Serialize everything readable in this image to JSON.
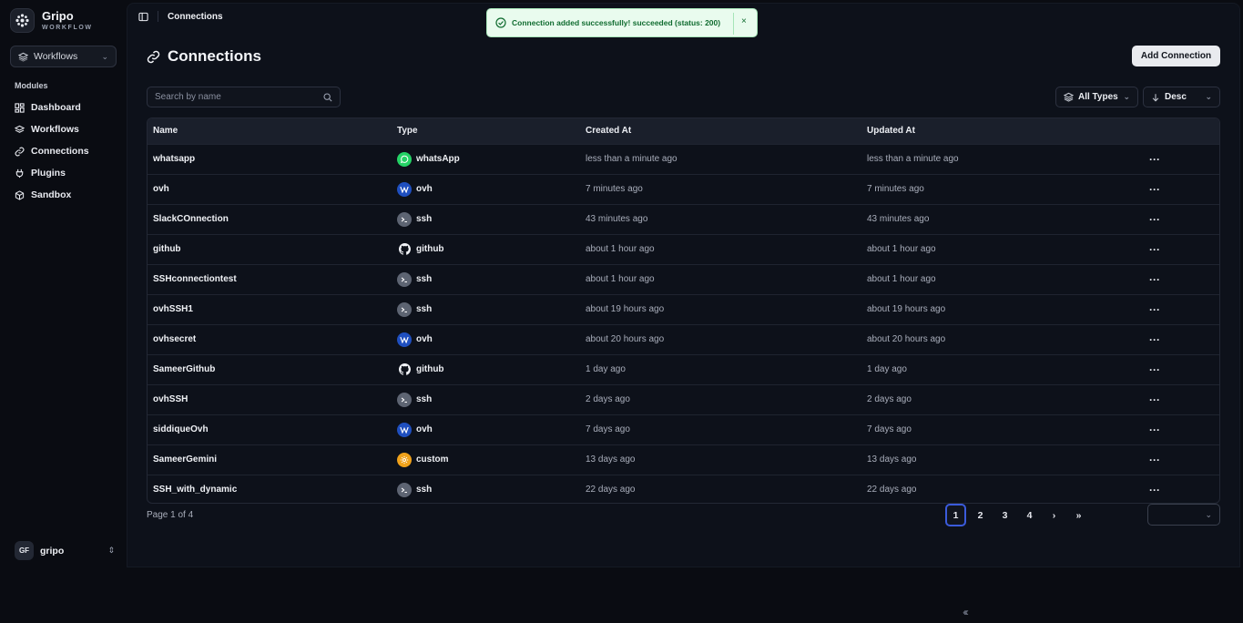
{
  "brand": {
    "name": "Gripo",
    "sub": "WORKFLOW"
  },
  "workspace_select": {
    "value": "Workflows"
  },
  "sidebar": {
    "section_label": "Modules",
    "items": [
      {
        "label": "Dashboard",
        "icon": "dashboard-icon"
      },
      {
        "label": "Workflows",
        "icon": "layers-icon"
      },
      {
        "label": "Connections",
        "icon": "link-icon"
      },
      {
        "label": "Plugins",
        "icon": "plug-icon"
      },
      {
        "label": "Sandbox",
        "icon": "cube-icon"
      }
    ]
  },
  "user": {
    "initials": "GF",
    "name": "gripo"
  },
  "breadcrumb": {
    "current": "Connections"
  },
  "page": {
    "title": "Connections",
    "add_label": "Add Connection"
  },
  "search": {
    "placeholder": "Search by name",
    "value": ""
  },
  "filters": {
    "type_value": "All Types",
    "sort_value": "Desc"
  },
  "table": {
    "columns": [
      "Name",
      "Type",
      "Created At",
      "Updated At"
    ],
    "rows": [
      {
        "name": "whatsapp",
        "type": "whatsApp",
        "icon": "whatsapp",
        "created": "less than a minute ago",
        "updated": "less than a minute ago"
      },
      {
        "name": "ovh",
        "type": "ovh",
        "icon": "ovh",
        "created": "7 minutes ago",
        "updated": "7 minutes ago"
      },
      {
        "name": "SlackCOnnection",
        "type": "ssh",
        "icon": "ssh",
        "created": "43 minutes ago",
        "updated": "43 minutes ago"
      },
      {
        "name": "github",
        "type": "github",
        "icon": "github",
        "created": "about 1 hour ago",
        "updated": "about 1 hour ago"
      },
      {
        "name": "SSHconnectiontest",
        "type": "ssh",
        "icon": "ssh",
        "created": "about 1 hour ago",
        "updated": "about 1 hour ago"
      },
      {
        "name": "ovhSSH1",
        "type": "ssh",
        "icon": "ssh",
        "created": "about 19 hours ago",
        "updated": "about 19 hours ago"
      },
      {
        "name": "ovhsecret",
        "type": "ovh",
        "icon": "ovh",
        "created": "about 20 hours ago",
        "updated": "about 20 hours ago"
      },
      {
        "name": "SameerGithub",
        "type": "github",
        "icon": "github",
        "created": "1 day ago",
        "updated": "1 day ago"
      },
      {
        "name": "ovhSSH",
        "type": "ssh",
        "icon": "ssh",
        "created": "2 days ago",
        "updated": "2 days ago"
      },
      {
        "name": "siddiqueOvh",
        "type": "ovh",
        "icon": "ovh",
        "created": "7 days ago",
        "updated": "7 days ago"
      },
      {
        "name": "SameerGemini",
        "type": "custom",
        "icon": "custom",
        "created": "13 days ago",
        "updated": "13 days ago"
      },
      {
        "name": "SSH_with_dynamic",
        "type": "ssh",
        "icon": "ssh",
        "created": "22 days ago",
        "updated": "22 days ago"
      }
    ]
  },
  "pagination": {
    "label": "Page 1 of 4",
    "pages": [
      "1",
      "2",
      "3",
      "4"
    ],
    "current": "1"
  },
  "toast": {
    "message": "Connection added successfully! succeeded (status: 200)",
    "status": "success"
  }
}
